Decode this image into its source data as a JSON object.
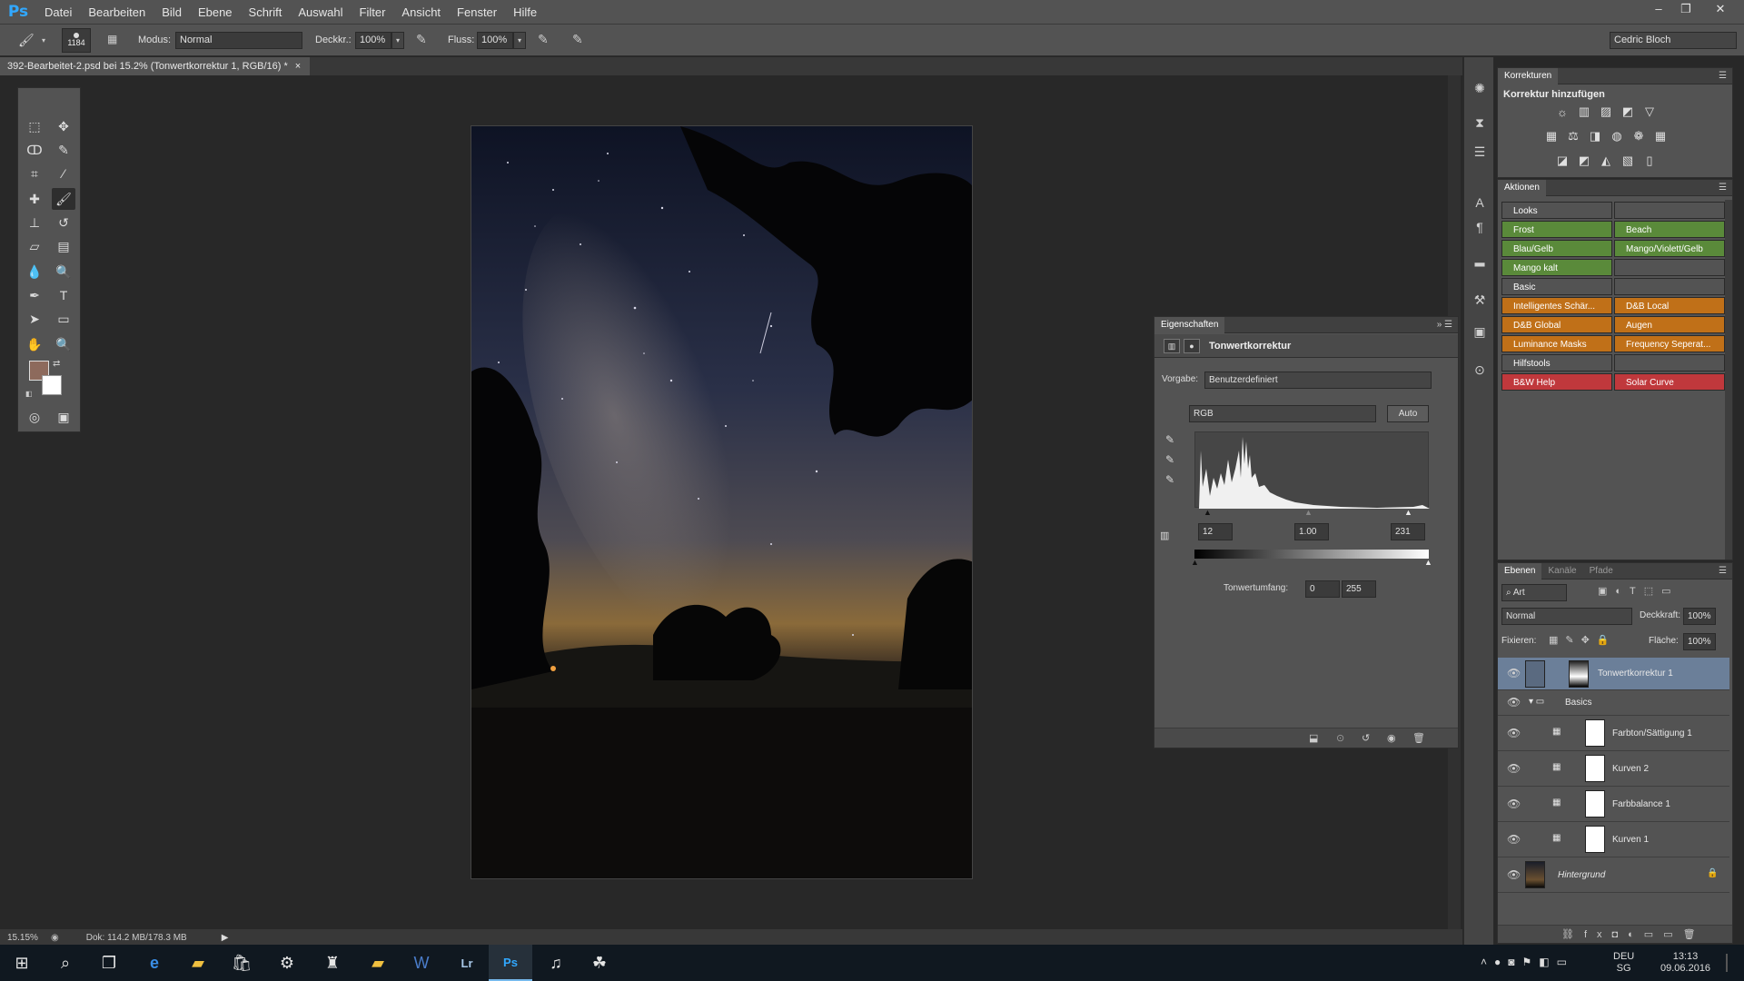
{
  "app": {
    "logo": "Ps",
    "menu": [
      "Datei",
      "Bearbeiten",
      "Bild",
      "Ebene",
      "Schrift",
      "Auswahl",
      "Filter",
      "Ansicht",
      "Fenster",
      "Hilfe"
    ],
    "window_controls": [
      "–",
      "❐",
      "✕"
    ]
  },
  "options": {
    "brush_size": "1184",
    "mode_label": "Modus:",
    "mode_value": "Normal",
    "opacity_label": "Deckkr.:",
    "opacity_value": "100%",
    "flow_label": "Fluss:",
    "flow_value": "100%",
    "user": "Cedric Bloch"
  },
  "document": {
    "tab_title": "392-Bearbeitet-2.psd bei 15.2% (Tonwertkorrektur 1, RGB/16) *",
    "tab_close": "×"
  },
  "status": {
    "zoom": "15.15%",
    "doc_size": "Dok: 114.2 MB/178.3 MB"
  },
  "korrekturen": {
    "tab": "Korrekturen",
    "subtitle": "Korrektur hinzufügen",
    "icons_row1": [
      "brightness-icon",
      "levels-icon",
      "curves-icon",
      "exposure-icon",
      "vibrance-icon"
    ],
    "icons_row2": [
      "hue-sat-icon",
      "color-balance-icon",
      "bw-icon",
      "photo-filter-icon",
      "channel-mixer-icon",
      "color-lookup-icon"
    ],
    "icons_row3": [
      "invert-icon",
      "posterize-icon",
      "threshold-icon",
      "gradient-map-icon",
      "selective-color-icon"
    ]
  },
  "aktionen": {
    "tab": "Aktionen",
    "rows": [
      [
        {
          "label": "Looks",
          "color": "#535353"
        },
        {
          "label": "",
          "color": "#535353"
        }
      ],
      [
        {
          "label": "Frost",
          "color": "#5a8a3a"
        },
        {
          "label": "Beach",
          "color": "#5a8a3a"
        }
      ],
      [
        {
          "label": "Blau/Gelb",
          "color": "#5a8a3a"
        },
        {
          "label": "Mango/Violett/Gelb",
          "color": "#5a8a3a"
        }
      ],
      [
        {
          "label": "Mango kalt",
          "color": "#5a8a3a"
        },
        {
          "label": "",
          "color": "#535353"
        }
      ],
      [
        {
          "label": "Basic",
          "color": "#535353"
        },
        {
          "label": "",
          "color": "#535353"
        }
      ],
      [
        {
          "label": "Intelligentes Schär...",
          "color": "#c07018"
        },
        {
          "label": "D&B Local",
          "color": "#c07018"
        }
      ],
      [
        {
          "label": "D&B Global",
          "color": "#c07018"
        },
        {
          "label": "Augen",
          "color": "#c07018"
        }
      ],
      [
        {
          "label": "Luminance Masks",
          "color": "#c07018"
        },
        {
          "label": "Frequency Seperat...",
          "color": "#c07018"
        }
      ],
      [
        {
          "label": "Hilfstools",
          "color": "#535353"
        },
        {
          "label": "",
          "color": "#535353"
        }
      ],
      [
        {
          "label": "B&W Help",
          "color": "#c0383c"
        },
        {
          "label": "Solar Curve",
          "color": "#c0383c"
        }
      ]
    ]
  },
  "properties": {
    "tab": "Eigenschaften",
    "title": "Tonwertkorrektur",
    "preset_label": "Vorgabe:",
    "preset_value": "Benutzerdefiniert",
    "channel": "RGB",
    "auto": "Auto",
    "input_black": "12",
    "input_gamma": "1.00",
    "input_white": "231",
    "output_label": "Tonwertumfang:",
    "output_black": "0",
    "output_white": "255"
  },
  "layers": {
    "tabs": [
      "Ebenen",
      "Kanäle",
      "Pfade"
    ],
    "filter_kind": "Art",
    "blend_mode": "Normal",
    "opacity_label": "Deckkraft:",
    "opacity_value": "100%",
    "lock_label": "Fixieren:",
    "fill_label": "Fläche:",
    "fill_value": "100%",
    "items": [
      {
        "name": "Tonwertkorrektur 1",
        "type": "levels",
        "selected": true
      },
      {
        "name": "Basics",
        "type": "group"
      },
      {
        "name": "Farbton/Sättigung 1",
        "type": "adjust"
      },
      {
        "name": "Kurven 2",
        "type": "adjust"
      },
      {
        "name": "Farbbalance 1",
        "type": "adjust"
      },
      {
        "name": "Kurven 1",
        "type": "adjust"
      },
      {
        "name": "Hintergrund",
        "type": "image"
      }
    ]
  },
  "taskbar": {
    "language": "DEU",
    "region": "SG",
    "time": "13:13",
    "date": "09.06.2016"
  }
}
